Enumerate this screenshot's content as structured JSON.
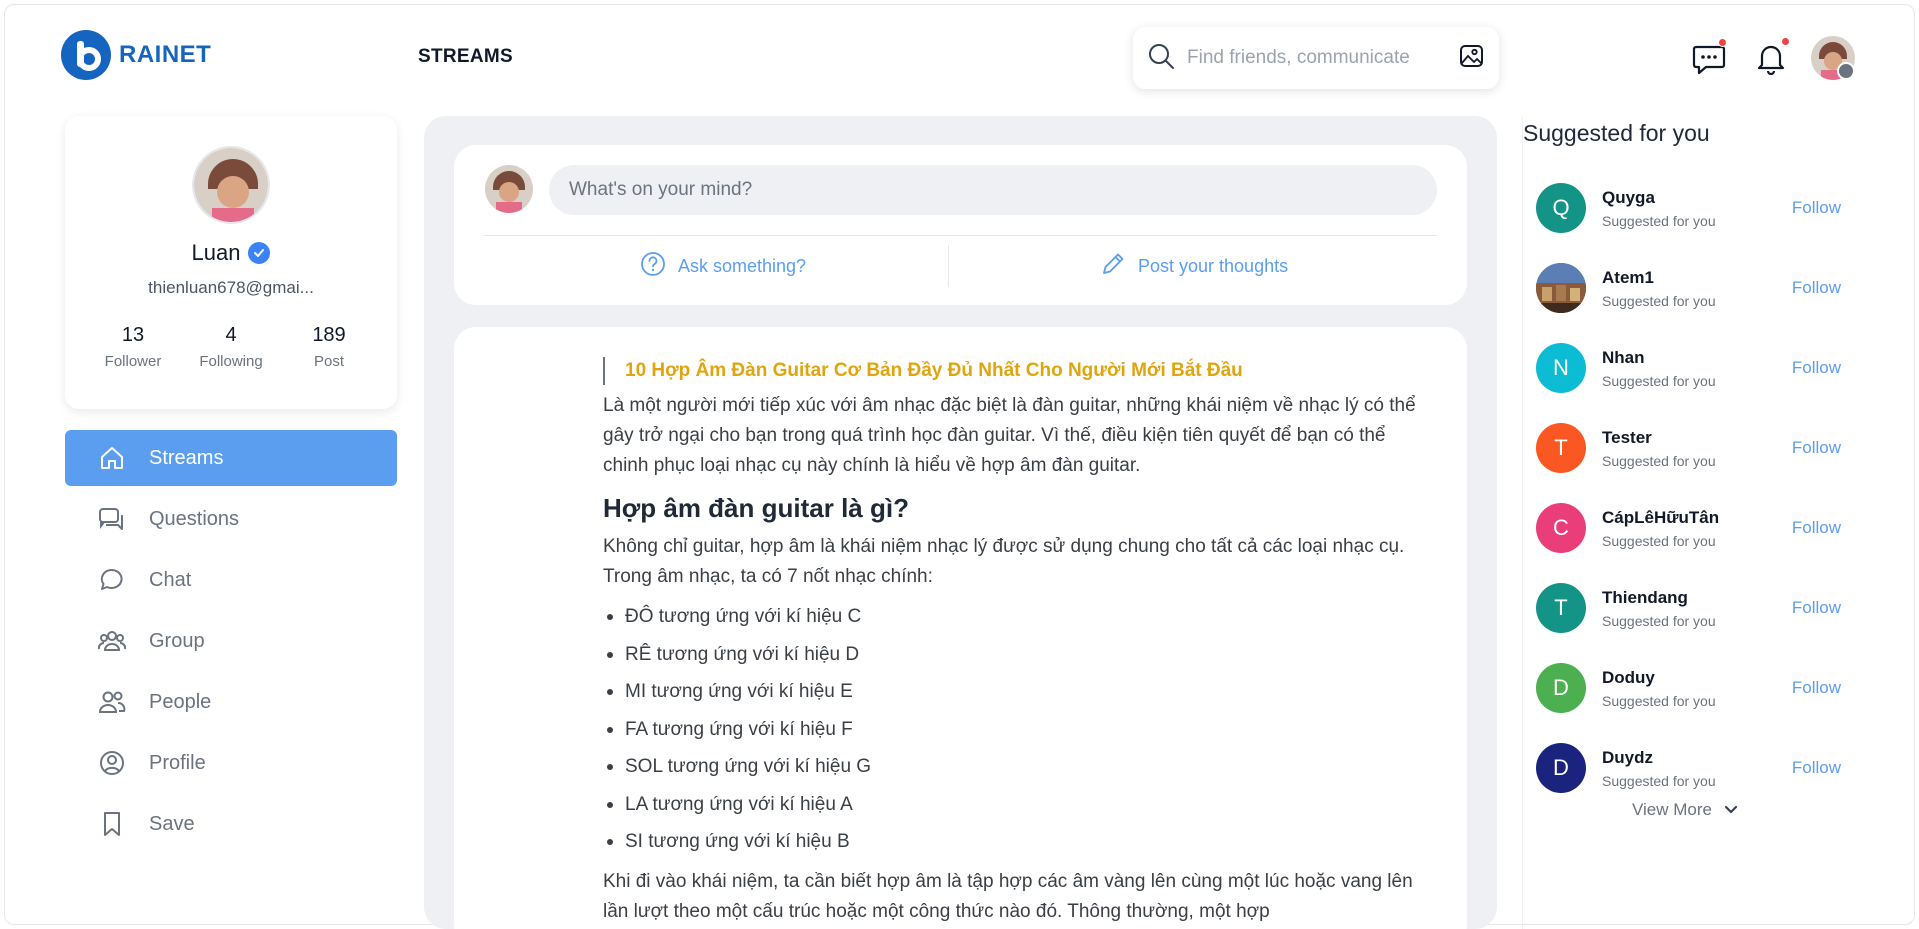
{
  "brand": {
    "name": "RAINET",
    "color": "#1565c0"
  },
  "header": {
    "title": "STREAMS",
    "search_placeholder": "Find friends, communicate"
  },
  "profile": {
    "name": "Luan",
    "email": "thienluan678@gmai...",
    "stats": [
      {
        "value": "13",
        "label": "Follower"
      },
      {
        "value": "4",
        "label": "Following"
      },
      {
        "value": "189",
        "label": "Post"
      }
    ]
  },
  "nav": [
    {
      "label": "Streams",
      "icon": "home-icon",
      "active": true
    },
    {
      "label": "Questions",
      "icon": "questions-icon",
      "active": false
    },
    {
      "label": "Chat",
      "icon": "chat-icon",
      "active": false
    },
    {
      "label": "Group",
      "icon": "group-icon",
      "active": false
    },
    {
      "label": "People",
      "icon": "people-icon",
      "active": false
    },
    {
      "label": "Profile",
      "icon": "profile-icon",
      "active": false
    },
    {
      "label": "Save",
      "icon": "bookmark-icon",
      "active": false
    }
  ],
  "composer": {
    "placeholder": "What's on your mind?",
    "ask_label": "Ask something?",
    "post_label": "Post your thoughts"
  },
  "post": {
    "title": "10 Hợp Âm Đàn Guitar Cơ Bản Đầy Đủ Nhất Cho Người Mới Bắt Đầu",
    "intro": "Là một người mới tiếp xúc với âm nhạc đặc biệt là đàn guitar, những khái niệm về nhạc lý có thể gây trở ngại cho bạn trong quá trình học đàn guitar. Vì thế, điều kiện tiên quyết để bạn có thể chinh phục loại nhạc cụ này chính là hiểu về hợp âm đàn guitar.",
    "heading": "Hợp âm đàn guitar là gì?",
    "para2": "Không chỉ guitar, hợp âm là khái niệm nhạc lý được sử dụng chung cho tất cả các loại nhạc cụ. Trong âm nhạc, ta có 7 nốt nhạc chính:",
    "notes": [
      "ĐÔ tương ứng với kí hiệu C",
      "RÊ tương ứng với kí hiệu D",
      "MI tương ứng với kí hiệu E",
      "FA tương ứng với kí hiệu F",
      "SOL tương ứng với kí hiệu G",
      "LA tương ứng với kí hiệu A",
      "SI tương ứng với kí hiệu B"
    ],
    "para3": "Khi đi vào khái niệm, ta cần biết hợp âm là tập hợp các âm vàng lên cùng một lúc hoặc vang lên lần lượt theo một cấu trúc hoặc một công thức nào đó. Thông thường, một hợp"
  },
  "suggested": {
    "title": "Suggested for you",
    "sub_label": "Suggested for you",
    "follow_label": "Follow",
    "view_more": "View More",
    "items": [
      {
        "name": "Quyga",
        "initial": "Q",
        "color": "#139487"
      },
      {
        "name": "Atem1",
        "initial": "",
        "color": "#4a6fa5"
      },
      {
        "name": "Nhan",
        "initial": "N",
        "color": "#0bbcd4"
      },
      {
        "name": "Tester",
        "initial": "T",
        "color": "#fb5722"
      },
      {
        "name": "CápLêHữuTân",
        "initial": "C",
        "color": "#ea3e7a"
      },
      {
        "name": "Thiendang",
        "initial": "T",
        "color": "#139487"
      },
      {
        "name": "Doduy",
        "initial": "D",
        "color": "#4caf50"
      },
      {
        "name": "Duydz",
        "initial": "D",
        "color": "#1a237e"
      }
    ]
  }
}
